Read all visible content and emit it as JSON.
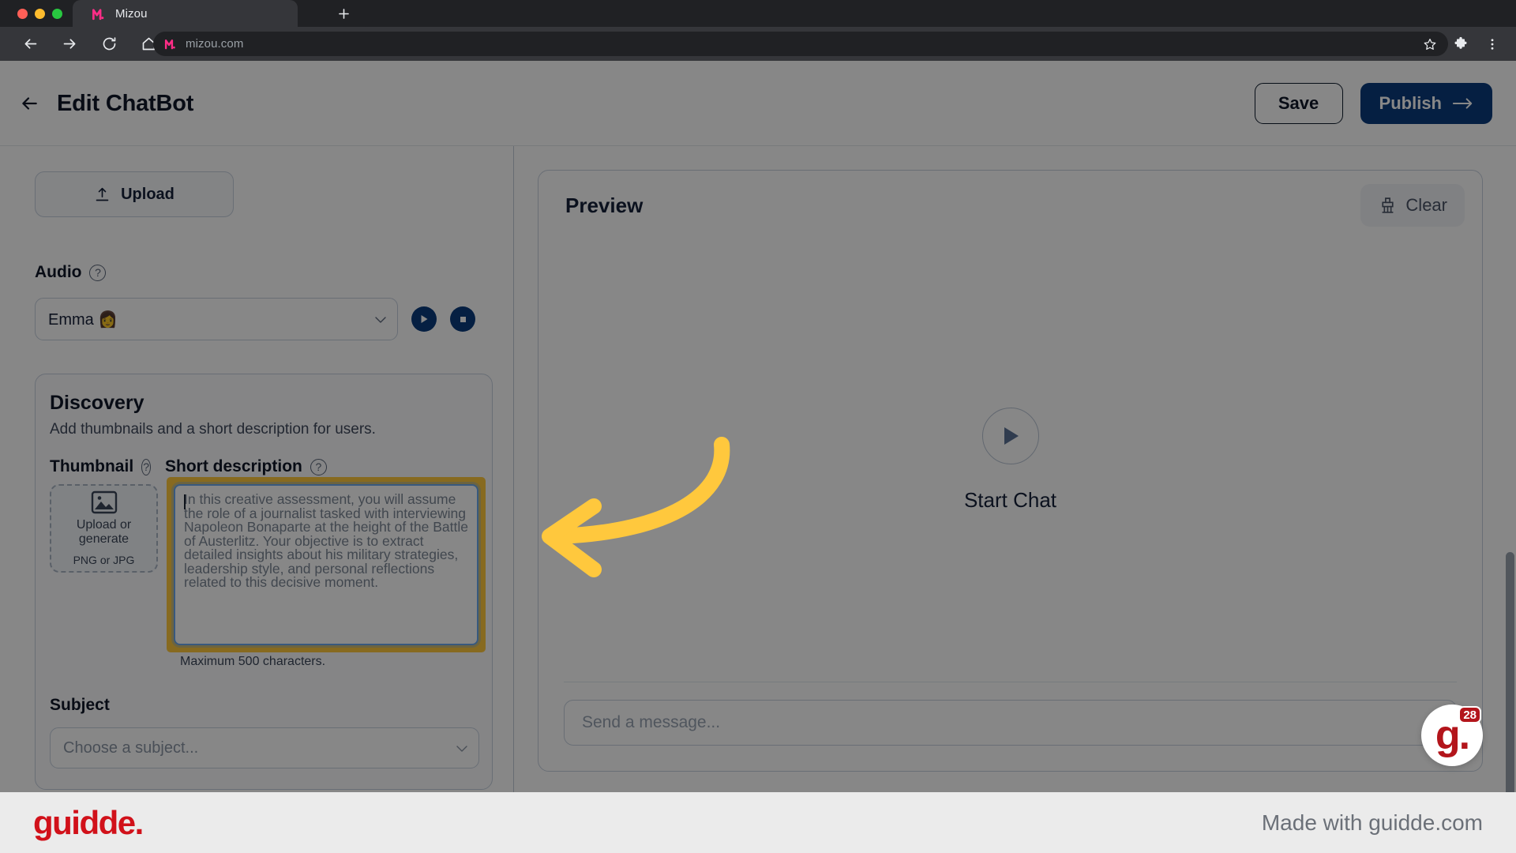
{
  "browser": {
    "tab": {
      "title": "Mizou",
      "favicon_icon": "mizou-m-icon"
    },
    "new_tab_icon": "plus-icon",
    "nav": {
      "back_icon": "arrow-left-icon",
      "forward_icon": "arrow-right-icon",
      "reload_icon": "reload-icon",
      "home_icon": "home-icon"
    },
    "omnibox": {
      "url": "mizou.com",
      "site_icon": "mizou-m-icon",
      "star_icon": "star-icon"
    },
    "toolbar": {
      "extensions_icon": "puzzle-piece-icon",
      "menu_icon": "three-dot-menu-icon"
    }
  },
  "app": {
    "header": {
      "back_icon": "arrow-left-icon",
      "title": "Edit ChatBot",
      "save_label": "Save",
      "publish_label": "Publish",
      "publish_arrow_icon": "arrow-right-icon"
    },
    "left_panel": {
      "upload_button": {
        "label": "Upload",
        "icon": "upload-icon"
      },
      "audio": {
        "label": "Audio",
        "help_icon": "question-mark-icon",
        "selected_voice": "Emma 👩",
        "chevron_icon": "chevron-down-icon",
        "play_icon": "play-icon",
        "stop_icon": "stop-icon"
      },
      "discovery": {
        "title": "Discovery",
        "subtitle": "Add thumbnails and a short description for users.",
        "thumbnail_label": "Thumbnail",
        "thumbnail_help_icon": "question-mark-icon",
        "short_description_label": "Short description",
        "short_description_help_icon": "question-mark-icon",
        "thumbnail_box": {
          "icon": "image-placeholder-icon",
          "line1": "Upload or",
          "line1b": "generate",
          "line2": "PNG or JPG"
        },
        "description_value": "In this creative assessment, you will assume the role of a journalist tasked with interviewing Napoleon Bonaparte at the height of the Battle of Austerlitz. Your objective is to extract detailed insights about his military strategies, leadership style, and personal reflections related to this decisive moment.",
        "description_hint": "Maximum 500 characters.",
        "highlight_color": "#ffc83d",
        "focus_border_color": "#6aa9ef"
      },
      "subject": {
        "label": "Subject",
        "placeholder": "Choose a subject...",
        "chevron_icon": "chevron-down-icon"
      }
    },
    "right_panel": {
      "preview_title": "Preview",
      "clear_label": "Clear",
      "clear_icon": "brush-icon",
      "start_chat_label": "Start Chat",
      "start_chat_icon": "play-icon",
      "composer_placeholder": "Send a message..."
    }
  },
  "annotation": {
    "arrow_icon": "curved-arrow-left-icon",
    "color": "#ffc83d"
  },
  "guidde_widget": {
    "logo_text": "g.",
    "count": "28"
  },
  "footer": {
    "logo_text": "guidde.",
    "credit": "Made with guidde.com"
  }
}
